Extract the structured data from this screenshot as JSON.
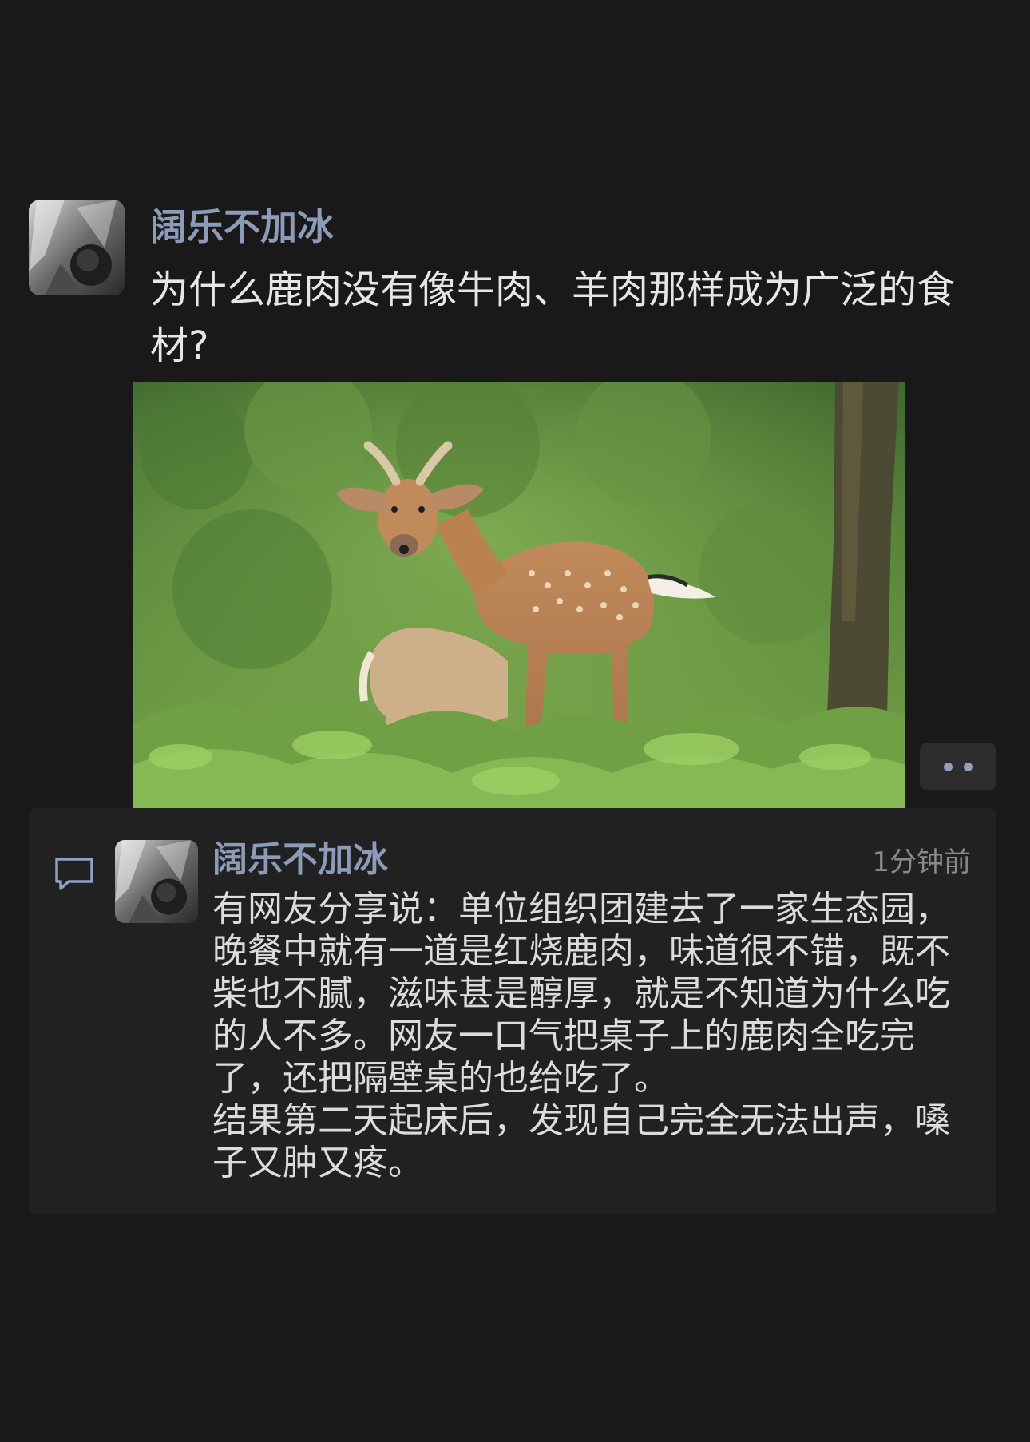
{
  "post": {
    "author": "阔乐不加冰",
    "text": "为什么鹿肉没有像牛肉、羊肉那样成为广泛的食材?",
    "avatar_icon": "user-avatar",
    "photo_icon": "deer-in-forest-photo"
  },
  "actions": {
    "more_icon": "more-dots-icon"
  },
  "comment": {
    "icon": "comment-bubble-icon",
    "author": "阔乐不加冰",
    "time": "1分钟前",
    "text": "有网友分享说：单位组织团建去了一家生态园，晚餐中就有一道是红烧鹿肉，味道很不错，既不柴也不腻，滋味甚是醇厚，就是不知道为什么吃的人不多。网友一口气把桌子上的鹿肉全吃完了，还把隔壁桌的也给吃了。\n结果第二天起床后，发现自己完全无法出声，嗓子又肿又疼。"
  },
  "colors": {
    "background": "#191919",
    "panel": "#212121",
    "author_name": "#8b9bb8",
    "body_text": "#e6e6e6",
    "time_text": "#8a8a8a"
  }
}
